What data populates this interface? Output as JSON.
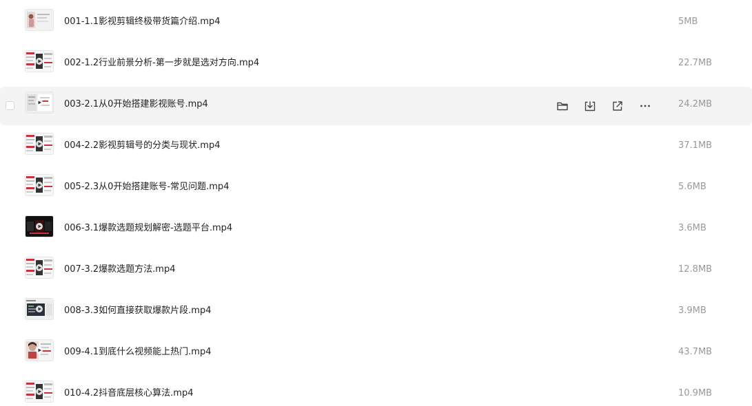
{
  "files": [
    {
      "name": "001-1.1影视剪辑终极带货篇介绍.mp4",
      "size": "5MB",
      "thumb_style": "portrait-light"
    },
    {
      "name": "002-1.2行业前景分析-第一步就是选对方向.mp4",
      "size": "22.7MB",
      "thumb_style": "slides-red"
    },
    {
      "name": "003-2.1从0开始搭建影视账号.mp4",
      "size": "24.2MB",
      "thumb_style": "slides-gray",
      "hovered": true
    },
    {
      "name": "004-2.2影视剪辑号的分类与现状.mp4",
      "size": "37.1MB",
      "thumb_style": "slides-red"
    },
    {
      "name": "005-2.3从0开始搭建账号-常见问题.mp4",
      "size": "5.6MB",
      "thumb_style": "slides-red"
    },
    {
      "name": "006-3.1爆款选题规划解密-选题平台.mp4",
      "size": "3.6MB",
      "thumb_style": "dark"
    },
    {
      "name": "007-3.2爆款选题方法.mp4",
      "size": "12.8MB",
      "thumb_style": "slides-red"
    },
    {
      "name": "008-3.3如何直接获取爆款片段.mp4",
      "size": "3.9MB",
      "thumb_style": "screen-dark"
    },
    {
      "name": "009-4.1到底什么视频能上热门.mp4",
      "size": "43.7MB",
      "thumb_style": "portrait-face"
    },
    {
      "name": "010-4.2抖音底层核心算法.mp4",
      "size": "10.9MB",
      "thumb_style": "slides-red"
    }
  ],
  "row_actions": [
    {
      "icon": "folder-icon"
    },
    {
      "icon": "download-icon"
    },
    {
      "icon": "share-icon"
    },
    {
      "icon": "more-icon"
    }
  ],
  "colors": {
    "hover_bg": "#f4f4f5",
    "name_text": "#222222",
    "size_text": "#999999",
    "icon": "#444444",
    "thumb_accent": "#c8323c"
  }
}
